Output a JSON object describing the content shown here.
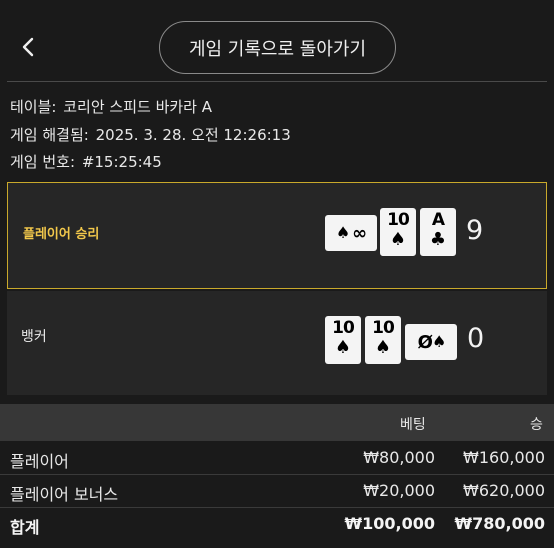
{
  "header": {
    "back_icon": "chevron-left-icon",
    "return_label": "게임 기록으로 돌아가기"
  },
  "info": {
    "table_label": "테이블:",
    "table_value": "코리안 스피드 바카라 A",
    "resolved_label": "게임 해결됨:",
    "resolved_value": "2025. 3. 28. 오전 12:26:13",
    "game_no_label": "게임 번호:",
    "game_no_value": "#15:25:45"
  },
  "player": {
    "label": "플레이어 승리",
    "score": "9",
    "cards": [
      {
        "rank": "∞",
        "suit": "♠",
        "side": true
      },
      {
        "rank": "10",
        "suit": "♠",
        "side": false
      },
      {
        "rank": "A",
        "suit": "♣",
        "side": false
      }
    ]
  },
  "banker": {
    "label": "뱅커",
    "score": "0",
    "cards": [
      {
        "rank": "10",
        "suit": "♠",
        "side": false
      },
      {
        "rank": "10",
        "suit": "♠",
        "side": false
      },
      {
        "rank": "Ø",
        "suit": "♠",
        "side": true
      }
    ]
  },
  "table": {
    "col_bet": "베팅",
    "col_win": "승",
    "rows": [
      {
        "name": "플레이어",
        "bet": "₩80,000",
        "win": "₩160,000"
      },
      {
        "name": "플레이어 보너스",
        "bet": "₩20,000",
        "win": "₩620,000"
      }
    ],
    "total": {
      "name": "합계",
      "bet": "₩100,000",
      "win": "₩780,000"
    }
  },
  "colors": {
    "background": "#1a1a1a",
    "panel": "#262626",
    "winner_border": "#c9a92b",
    "winner_text": "#f2c84b"
  }
}
